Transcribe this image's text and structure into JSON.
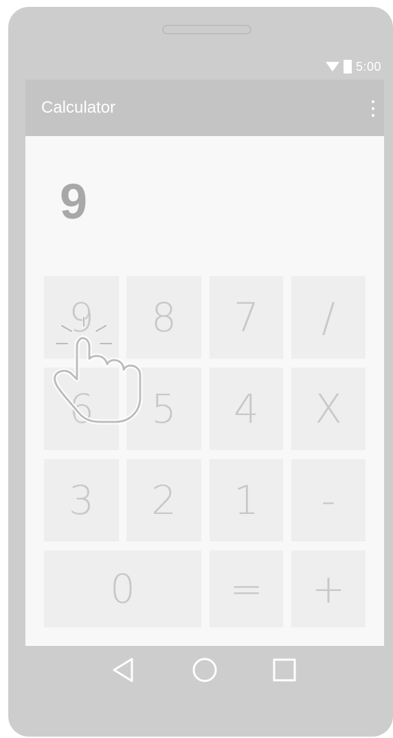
{
  "status_bar": {
    "time": "5:00",
    "icons": [
      "wifi-icon",
      "battery-icon"
    ]
  },
  "app_bar": {
    "title": "Calculator",
    "menu_icon": "overflow-menu-icon"
  },
  "display": {
    "value": "9"
  },
  "keypad": {
    "rows": [
      [
        "9",
        "8",
        "7",
        "/"
      ],
      [
        "6",
        "5",
        "4",
        "X"
      ],
      [
        "3",
        "2",
        "1",
        "-"
      ],
      [
        "0",
        "=",
        "+"
      ]
    ]
  },
  "nav_bar": {
    "buttons": [
      "back-icon",
      "home-icon",
      "recents-icon"
    ]
  },
  "gesture": {
    "icon": "tap-gesture-hand-icon",
    "target_key": "9"
  },
  "colors": {
    "device_frame": "#cdcdcd",
    "app_bar": "#c4c4c4",
    "key_background": "#eeeeee",
    "key_text": "#c8c8c8",
    "display_text": "#a8a8a8"
  }
}
